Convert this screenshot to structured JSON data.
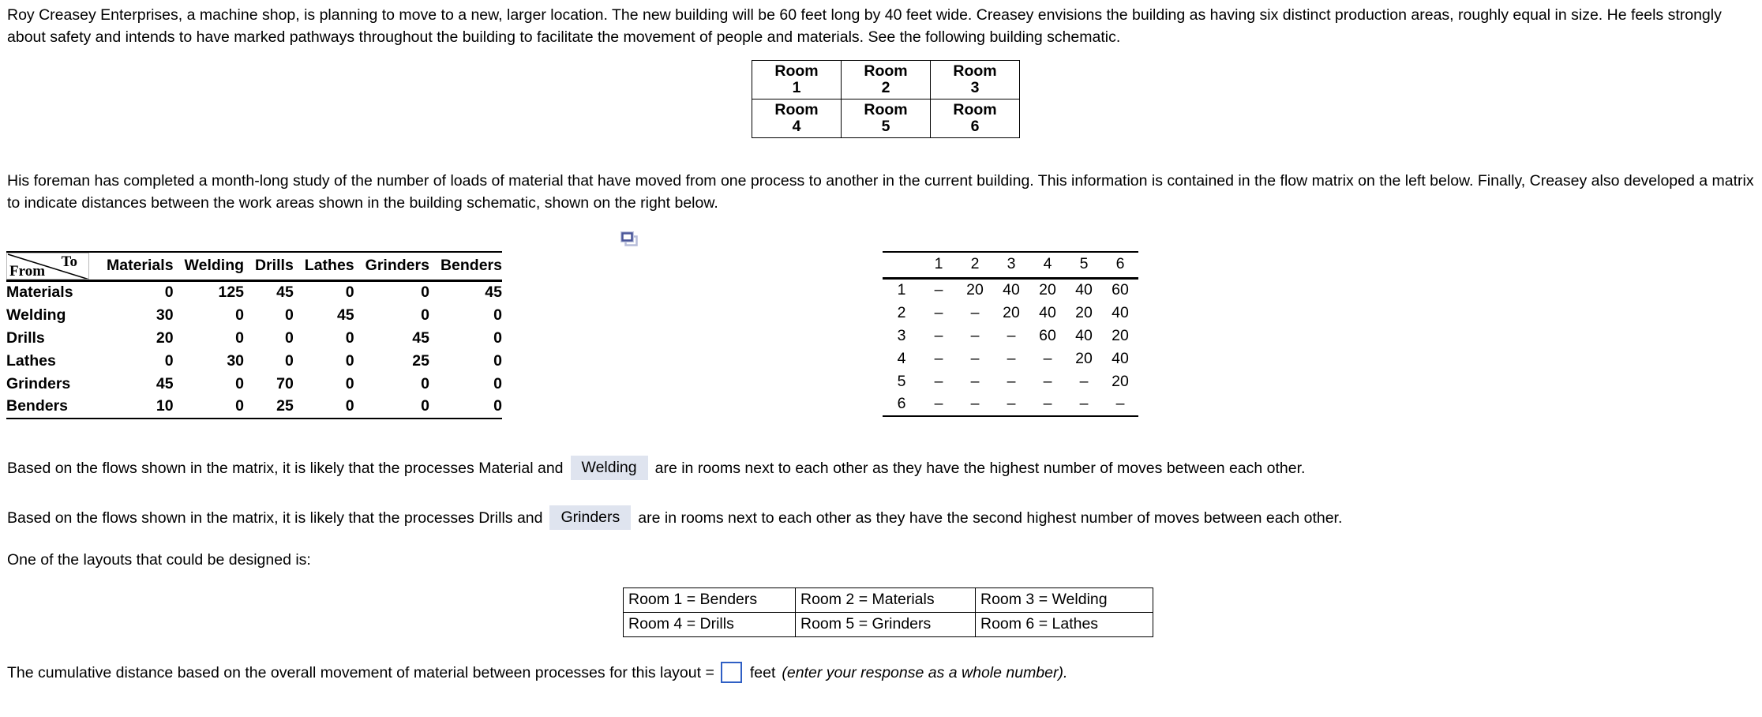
{
  "intro": {
    "paragraph": "Roy Creasey Enterprises, a machine shop, is planning to move to a new, larger location. The new building will be 60 feet long by 40 feet wide. Creasey envisions the building as having six distinct production areas, roughly equal in size. He feels strongly about safety and intends to have marked pathways throughout the building to facilitate the movement of people and materials. See the following building schematic."
  },
  "schematic": {
    "rows": [
      [
        {
          "label": "Room",
          "number": "1"
        },
        {
          "label": "Room",
          "number": "2"
        },
        {
          "label": "Room",
          "number": "3"
        }
      ],
      [
        {
          "label": "Room",
          "number": "4"
        },
        {
          "label": "Room",
          "number": "5"
        },
        {
          "label": "Room",
          "number": "6"
        }
      ]
    ]
  },
  "foreman": {
    "paragraph": "His foreman has completed a month-long study of the number of loads of material that have moved from one process to another in the current building. This information is contained in the flow matrix on the left below. Finally, Creasey also developed a matrix to indicate distances between the work areas shown in the building schematic, shown on the right below."
  },
  "icons": {
    "duplicate": "duplicate-windows-icon"
  },
  "flow_matrix": {
    "corner": {
      "from": "From",
      "to": "To"
    },
    "columns": [
      "Materials",
      "Welding",
      "Drills",
      "Lathes",
      "Grinders",
      "Benders"
    ],
    "rows": [
      {
        "label": "Materials",
        "values": [
          "0",
          "125",
          "45",
          "0",
          "0",
          "45"
        ]
      },
      {
        "label": "Welding",
        "values": [
          "30",
          "0",
          "0",
          "45",
          "0",
          "0"
        ]
      },
      {
        "label": "Drills",
        "values": [
          "20",
          "0",
          "0",
          "0",
          "45",
          "0"
        ]
      },
      {
        "label": "Lathes",
        "values": [
          "0",
          "30",
          "0",
          "0",
          "25",
          "0"
        ]
      },
      {
        "label": "Grinders",
        "values": [
          "45",
          "0",
          "70",
          "0",
          "0",
          "0"
        ]
      },
      {
        "label": "Benders",
        "values": [
          "10",
          "0",
          "25",
          "0",
          "0",
          "0"
        ]
      }
    ]
  },
  "distance_matrix": {
    "corner": "",
    "columns": [
      "1",
      "2",
      "3",
      "4",
      "5",
      "6"
    ],
    "rows": [
      {
        "label": "1",
        "values": [
          "–",
          "20",
          "40",
          "20",
          "40",
          "60"
        ]
      },
      {
        "label": "2",
        "values": [
          "–",
          "–",
          "20",
          "40",
          "20",
          "40"
        ]
      },
      {
        "label": "3",
        "values": [
          "–",
          "–",
          "–",
          "60",
          "40",
          "20"
        ]
      },
      {
        "label": "4",
        "values": [
          "–",
          "–",
          "–",
          "–",
          "20",
          "40"
        ]
      },
      {
        "label": "5",
        "values": [
          "–",
          "–",
          "–",
          "–",
          "–",
          "20"
        ]
      },
      {
        "label": "6",
        "values": [
          "–",
          "–",
          "–",
          "–",
          "–",
          "–"
        ]
      }
    ]
  },
  "questions": {
    "first": {
      "prefix": "Based on the flows shown in the matrix, it is likely that the processes Material and",
      "selected": "Welding",
      "suffix": "are in rooms next to each other as they have the highest number of moves between each other."
    },
    "second": {
      "prefix": "Based on the flows shown in the matrix, it is likely that the processes Drills and",
      "selected": "Grinders",
      "suffix": "are in rooms next to each other as they have the second highest number of moves between each other."
    }
  },
  "layouts": {
    "intro": "One of the layouts that could be designed is:",
    "rows": [
      [
        "Room 1 = Benders",
        "Room 2 = Materials",
        "Room 3 = Welding"
      ],
      [
        "Room 4 = Drills",
        "Room 5 = Grinders",
        "Room 6 = Lathes"
      ]
    ]
  },
  "answer": {
    "prefix": "The cumulative distance based on the overall movement of material between processes for this layout =",
    "value": "",
    "unit": "feet",
    "hint": "(enter your response as a whole number)."
  },
  "colors": {
    "dropdown_background": "#dfe4ef",
    "input_border": "#2f5fc4",
    "icon_blue": "#4a5699",
    "text": "#000000"
  }
}
